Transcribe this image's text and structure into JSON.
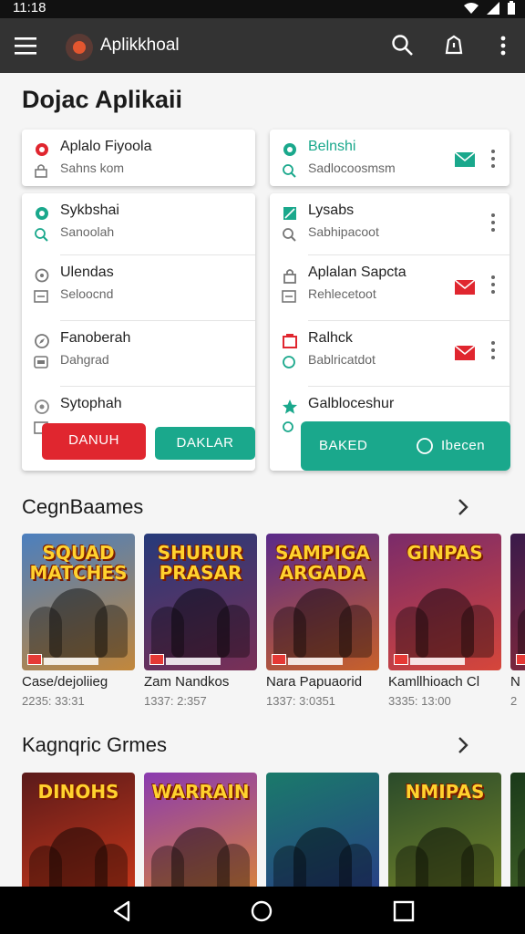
{
  "status_bar": {
    "time": "11:18"
  },
  "app_bar": {
    "title": "Aplikkhoal"
  },
  "page": {
    "title": "Dojac Aplikaii"
  },
  "left_card": {
    "rows": [
      {
        "title": "Aplalo Fiyoola",
        "subtitle": "Sahns kom",
        "icon": "gear-icon",
        "sub_icon": "lock-icon"
      }
    ]
  },
  "left_list": {
    "rows": [
      {
        "title": "Sykbshai",
        "subtitle": "Sanoolah",
        "icon": "gear-icon",
        "sub_icon": "search-icon"
      },
      {
        "title": "Ulendas",
        "subtitle": "Seloocnd",
        "icon": "puzzle-icon",
        "sub_icon": "image-icon"
      },
      {
        "title": "Fanoberah",
        "subtitle": "Dahgrad",
        "icon": "compass-icon",
        "sub_icon": "box-icon"
      },
      {
        "title": "Sytophah",
        "subtitle": "",
        "icon": "compass-icon",
        "sub_icon": "image-icon"
      }
    ],
    "buttons": {
      "danger": "DANUH",
      "primary": "DAKLAR"
    }
  },
  "right_card": {
    "rows": [
      {
        "title": "Belnshi",
        "subtitle": "Sadlocoosmsm",
        "icon": "gear-icon",
        "sub_icon": "search-icon",
        "accent": "#1aa88c"
      }
    ]
  },
  "right_list": {
    "rows": [
      {
        "title": "Lysabs",
        "subtitle": "Sabhipacoot",
        "icon": "calendar-icon",
        "sub_icon": "search-icon"
      },
      {
        "title": "Aplalan Sapcta",
        "subtitle": "Rehlecetoot",
        "icon": "lock-icon",
        "sub_icon": "image-icon"
      },
      {
        "title": "Ralhck",
        "subtitle": "Bablricatdot",
        "icon": "calendar-icon",
        "sub_icon": "circle-icon"
      },
      {
        "title": "Galbloceshur",
        "subtitle": "",
        "icon": "star-icon",
        "sub_icon": "search-icon"
      }
    ],
    "buttons": {
      "primary": "BAKED",
      "secondary": "Ibecen"
    }
  },
  "section1": {
    "title": "CegnBaames",
    "games": [
      {
        "name": "Case/dejoliieg",
        "meta": "2235: 33:31",
        "art_label": "SQUAD MATCHES",
        "colors": [
          "#4b7fbf",
          "#c2873b"
        ]
      },
      {
        "name": "Zam Nandkos",
        "meta": "1337: 2:357",
        "art_label": "SHURUR PRASAR",
        "colors": [
          "#263a7a",
          "#7a2f56"
        ]
      },
      {
        "name": "Nara Papuaorid",
        "meta": "1337: 3:0351",
        "art_label": "SAMPIGA ARGADA",
        "colors": [
          "#5a2a8a",
          "#c8612a"
        ]
      },
      {
        "name": "Kamllhioach Cl",
        "meta": "3335: 13:00",
        "art_label": "GINPAS",
        "colors": [
          "#7a2b6a",
          "#d6463a"
        ]
      },
      {
        "name": "N",
        "meta": "2",
        "art_label": "",
        "colors": [
          "#3a1a4a",
          "#8a2a3a"
        ]
      }
    ]
  },
  "section2": {
    "title": "Kagnqric Grmes",
    "games": [
      {
        "name": "",
        "meta": "",
        "art_label": "DINOHS",
        "colors": [
          "#5a1a1a",
          "#d23a1a"
        ]
      },
      {
        "name": "",
        "meta": "",
        "art_label": "WARRAIN",
        "colors": [
          "#8a3ab0",
          "#e08a30"
        ]
      },
      {
        "name": "",
        "meta": "",
        "art_label": "",
        "colors": [
          "#1a7a6a",
          "#2a3a8a"
        ]
      },
      {
        "name": "",
        "meta": "",
        "art_label": "NMIPAS",
        "colors": [
          "#2a4a2a",
          "#7a8a2a"
        ]
      },
      {
        "name": "",
        "meta": "",
        "art_label": "",
        "colors": [
          "#1a3a1a",
          "#4a6a2a"
        ]
      }
    ]
  },
  "colors": {
    "accent": "#1aa88c",
    "danger": "#e0262f",
    "appbar": "#333333"
  }
}
